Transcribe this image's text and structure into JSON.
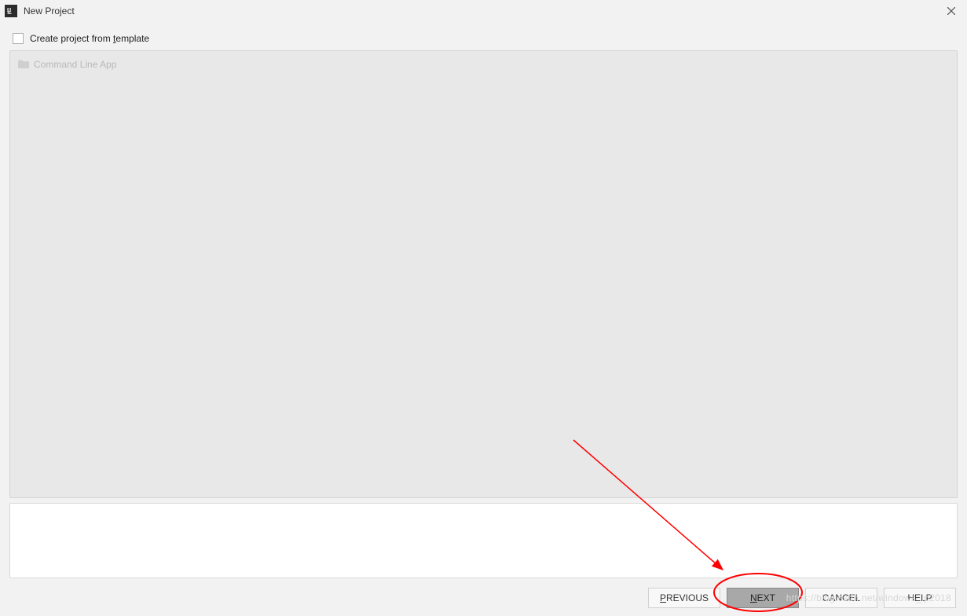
{
  "window": {
    "title": "New Project"
  },
  "options": {
    "create_from_template_label_pre": "Create project from ",
    "create_from_template_mnemonic": "t",
    "create_from_template_label_post": "emplate"
  },
  "templates": {
    "items": [
      {
        "label": "Command Line App"
      }
    ]
  },
  "buttons": {
    "previous_mnemonic": "P",
    "previous_rest": "REVIOUS",
    "next_mnemonic": "N",
    "next_rest": "EXT",
    "cancel": "CANCEL",
    "help": "HELP"
  },
  "watermark": "https://blog.csdn.net/windows_ip2018"
}
